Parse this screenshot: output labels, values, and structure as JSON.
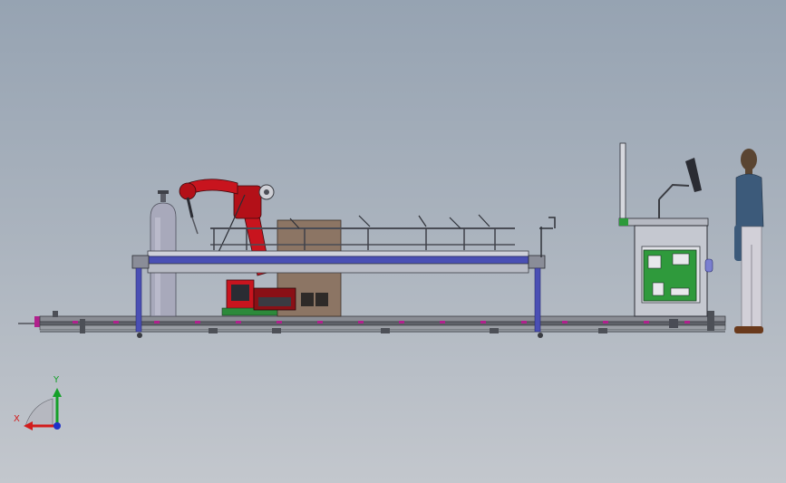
{
  "viewport": {
    "background_top": "#96a3b2",
    "background_bottom": "#c3c7cd"
  },
  "model": {
    "components": [
      "gas-cylinder",
      "welding-robot",
      "robot-controller",
      "fixture-rail",
      "linear-track",
      "control-cabinet",
      "monitor",
      "operator-figure"
    ],
    "colors": {
      "robot": "#c8141e",
      "rail": "#4a4fb4",
      "cylinder": "#a9aabb",
      "pcb": "#2f9a3c",
      "track": "#6c6f78",
      "tan_panel": "#8c7564"
    }
  },
  "triad": {
    "x_label": "X",
    "y_label": "Y",
    "x_color": "#d21c1c",
    "y_color": "#14a028",
    "z_color": "#1e32c8"
  }
}
